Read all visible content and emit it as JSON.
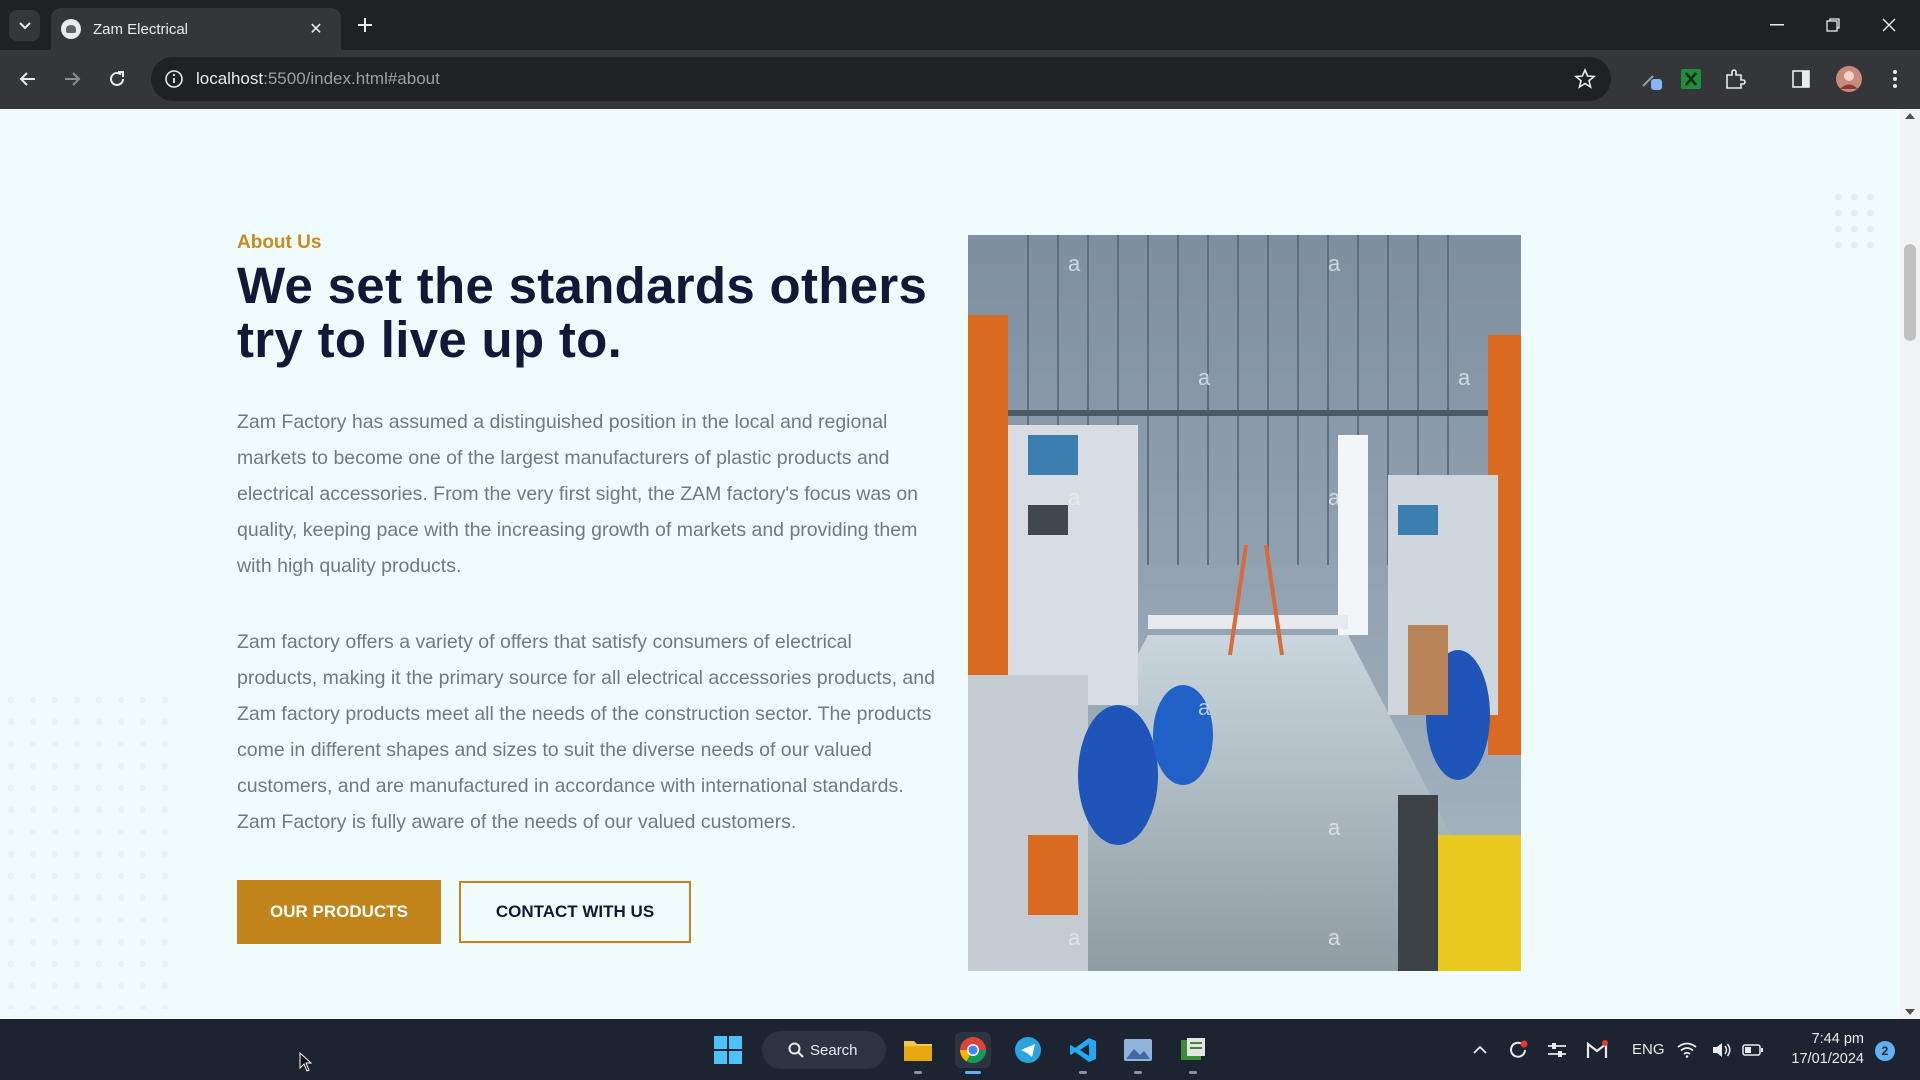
{
  "browser": {
    "tab_title": "Zam Electrical",
    "url_host": "localhost",
    "url_rest": ":5500/index.html#about",
    "icons": [
      "tab-list-icon",
      "favicon",
      "close-icon",
      "plus-icon",
      "minimize-icon",
      "restore-icon",
      "window-close-icon",
      "back-icon",
      "forward-icon",
      "reload-icon",
      "site-info-icon",
      "star-icon",
      "extension-icon",
      "sidebar-icon",
      "avatar"
    ]
  },
  "about": {
    "eyebrow": "About Us",
    "heading": "We set the standards others try to live up to.",
    "paragraph_1": "Zam Factory has assumed a distinguished position in the local and regional markets to become one of the largest manufacturers of plastic products and electrical accessories. From the very first sight, the ZAM factory's focus was on quality, keeping pace with the increasing growth of markets and providing them with high quality products.",
    "paragraph_2": "Zam factory offers a variety of offers that satisfy consumers of electrical products, making it the primary source for all electrical accessories products, and Zam factory products meet all the needs of the construction sector. The products come in different shapes and sizes to suit the diverse needs of our valued customers, and are manufactured in accordance with international standards. Zam Factory is fully aware of the needs of our valued customers.",
    "primary_button": "OUR PRODUCTS",
    "secondary_button": "CONTACT WITH US",
    "image_watermark": "a",
    "colors": {
      "accent": "#c0841b",
      "heading": "#111838",
      "body_text": "#707a7f",
      "background": "#f0fbfd"
    }
  },
  "taskbar": {
    "search_label": "Search",
    "language": "ENG",
    "time": "7:44 pm",
    "date": "17/01/2024",
    "notification_count": "2",
    "apps": [
      "start-icon",
      "search-icon",
      "file-explorer-icon",
      "chrome-icon",
      "telegram-icon",
      "vscode-icon",
      "photos-icon",
      "app-icon"
    ]
  }
}
